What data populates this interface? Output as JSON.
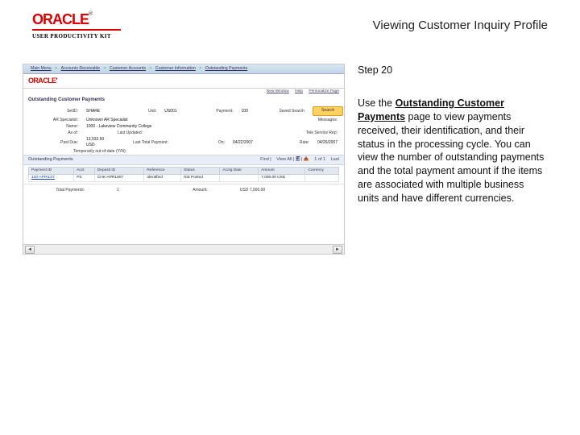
{
  "header": {
    "brand": "ORACLE",
    "subbrand": "USER PRODUCTIVITY KIT",
    "title": "Viewing Customer Inquiry Profile"
  },
  "panel": {
    "step": "Step 20",
    "instruction_prefix": "Use the ",
    "instruction_bold": "Outstanding Customer Payments",
    "instruction_rest": " page to view payments received, their identification, and their status in the processing cycle. You can view the number of outstanding payments and the total payment amount if the items are associated with multiple business units and have different currencies."
  },
  "app": {
    "nav": [
      "Main Menu",
      "Accounts Receivable",
      "Customer Accounts",
      "Customer Information",
      "Outstanding Payments"
    ],
    "brand": "ORACLE'",
    "toolbar": [
      "New Window",
      "Help",
      "Personalize Page"
    ],
    "page_title": "Outstanding Customer Payments",
    "search": {
      "setid_label": "SetID:",
      "setid_value": "SHARE",
      "unit_label": "Unit:",
      "unit_value": "US001",
      "payment_label": "Payment:",
      "payment_value": "100",
      "saveas_label": "Saved Search",
      "arspec_label": "AR Specialist:",
      "arspec_value": "Unknown AR Specialist",
      "messages_label": "Messages:",
      "name_label": "Name:",
      "name_value": "1000 - Lakeview Community College",
      "asof_label": "As of:",
      "lastupdated_label": "Last Updated:",
      "teleservice_label": "Tele Service Rep:",
      "pastdue_label": "Past Due:",
      "pastdue_value": "13,532.50 USD",
      "lasttotal_label": "Last Total Payment:",
      "on_label": "On:",
      "on_value": "04/22/2007",
      "rate_label": "Rate:",
      "rate_value": "04/26/2007",
      "temp_label": "Temporarily out-of-date (Y/N):",
      "search_btn": "Search"
    },
    "grid_title": "Outstanding Payments",
    "grid_tools": {
      "find": "Find",
      "view": "View All",
      "range": "1 of 1",
      "last": "Last"
    },
    "columns": [
      "Payment ID",
      "Acct",
      "Deposit ID",
      "Reference",
      "Status",
      "Acctg Date",
      "Amount",
      "Currency"
    ],
    "row": {
      "payment_id": "100-APRIL07",
      "acct": "PS",
      "deposit_id": "CHK-APR1807",
      "reference": "Identified",
      "status": "Not Posted",
      "acctg_date": "",
      "amount": "7,000.00 USD",
      "currency": ""
    },
    "totals": {
      "total_payments_label": "Total Payments:",
      "total_payments_value": "1",
      "amount_label": "Amount:",
      "amount_value": "USD 7,000.00"
    }
  }
}
